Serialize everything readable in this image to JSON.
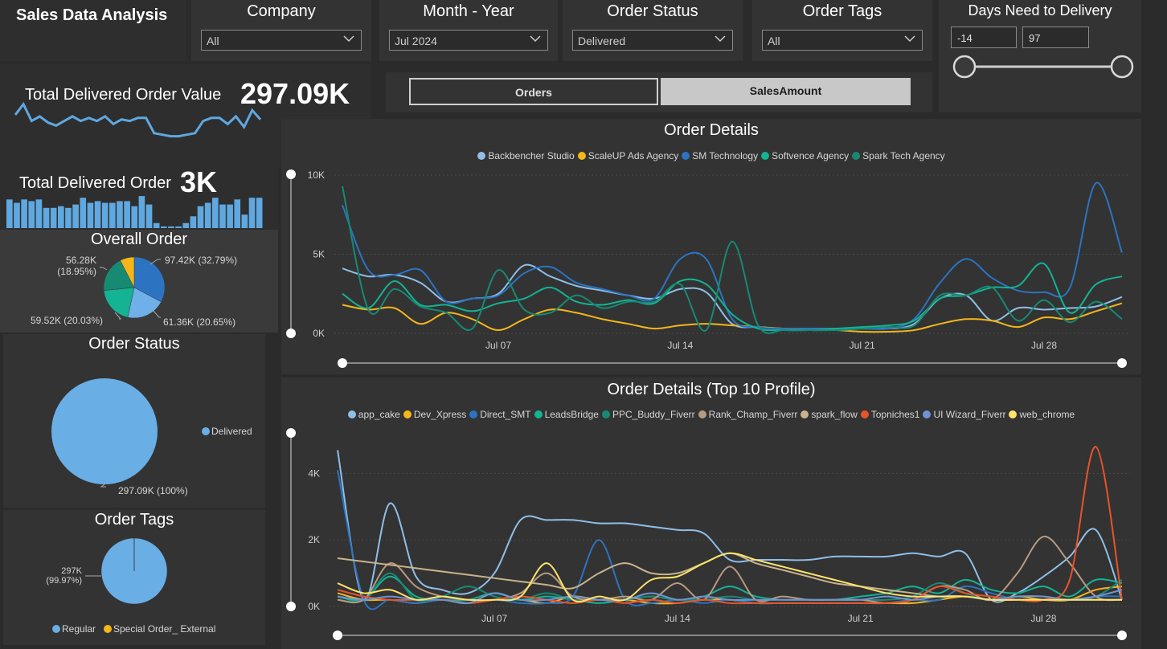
{
  "header": {
    "title": "Sales Data Analysis"
  },
  "slicers": {
    "company": {
      "label": "Company",
      "value": "All"
    },
    "month_year": {
      "label": "Month - Year",
      "value": "Jul 2024"
    },
    "order_status": {
      "label": "Order Status",
      "value": "Delivered"
    },
    "order_tags": {
      "label": "Order Tags",
      "value": "All"
    },
    "days": {
      "label": "Days Need to Delivery",
      "min": "-14",
      "max": "97"
    }
  },
  "kpis": {
    "value_label": "Total Delivered Order Value",
    "value": "297.09K",
    "orders_label": "Total Delivered Order",
    "orders": "3K",
    "value_sparkline": [
      0.5,
      0.85,
      0.3,
      0.45,
      0.25,
      0.15,
      0.3,
      0.45,
      0.3,
      0.4,
      0.3,
      0.45,
      0.2,
      0.35,
      0.3,
      0.4,
      0.4,
      -0.1,
      -0.15,
      -0.2,
      -0.2,
      -0.15,
      -0.1,
      0.3,
      0.4,
      0.4,
      0.2,
      0.45,
      0.1,
      0.65,
      0.35
    ],
    "orders_bars": [
      0.85,
      0.75,
      0.85,
      0.8,
      0.85,
      0.6,
      0.6,
      0.65,
      0.6,
      0.7,
      0.9,
      0.75,
      0.8,
      0.75,
      0.75,
      0.8,
      0.8,
      0.65,
      0.95,
      0.7,
      0.15,
      0.05,
      0.05,
      0.05,
      0.15,
      0.35,
      0.65,
      0.75,
      0.9,
      0.7,
      0.7,
      0.85,
      0.4,
      0.9,
      0.9
    ]
  },
  "toggle": {
    "orders": "Orders",
    "sales": "SalesAmount",
    "active": "SalesAmount"
  },
  "colors": {
    "accent": "#5fa8e0",
    "panel": "#333333",
    "bg": "#2b2b2b"
  },
  "chart_data": [
    {
      "type": "pie",
      "title": "Overall Order",
      "slices": [
        {
          "label": "97.42K (32.79%)",
          "value": 97.42,
          "color": "#2c73c2"
        },
        {
          "label": "61.36K (20.65%)",
          "value": 61.36,
          "color": "#6fb0e8"
        },
        {
          "label": "59.52K (20.03%)",
          "value": 59.52,
          "color": "#13b394"
        },
        {
          "label": "56.28K (18.95%)",
          "value": 56.28,
          "color": "#178a73"
        },
        {
          "label": "",
          "value": 22.5,
          "color": "#f4b61a"
        }
      ]
    },
    {
      "type": "pie",
      "title": "Order Status",
      "slices": [
        {
          "label": "297.09K (100%)",
          "value": 297.09,
          "color": "#6aaee6"
        }
      ],
      "legend": [
        "Delivered"
      ]
    },
    {
      "type": "pie",
      "title": "Order Tags",
      "slices": [
        {
          "label": "297K (99.97%)",
          "value": 99.97,
          "color": "#6aaee6"
        },
        {
          "label": "",
          "value": 0.03,
          "color": "#f4b61a"
        }
      ],
      "legend": [
        "Regular",
        "Special Order_ External"
      ]
    },
    {
      "type": "line",
      "title": "Order Details",
      "x": [
        "Jul 01",
        "Jul 02",
        "Jul 03",
        "Jul 04",
        "Jul 05",
        "Jul 06",
        "Jul 07",
        "Jul 08",
        "Jul 09",
        "Jul 10",
        "Jul 11",
        "Jul 12",
        "Jul 13",
        "Jul 14",
        "Jul 15",
        "Jul 16",
        "Jul 17",
        "Jul 18",
        "Jul 19",
        "Jul 20",
        "Jul 21",
        "Jul 22",
        "Jul 23",
        "Jul 24",
        "Jul 25",
        "Jul 26",
        "Jul 27",
        "Jul 28",
        "Jul 29",
        "Jul 30",
        "Jul 31"
      ],
      "xticks": [
        "Jul 07",
        "Jul 14",
        "Jul 21",
        "Jul 28"
      ],
      "yticks": [
        "0K",
        "5K",
        "10K"
      ],
      "ylim": [
        0,
        10000
      ],
      "series": [
        {
          "name": "Backbencher Studio",
          "color": "#8fbfe8",
          "values": [
            4100,
            3600,
            3700,
            3200,
            2000,
            2200,
            2500,
            4300,
            3600,
            3000,
            2700,
            2400,
            2200,
            2800,
            2600,
            600,
            400,
            300,
            300,
            300,
            300,
            300,
            600,
            2200,
            2400,
            800,
            1600,
            1500,
            1600,
            1700,
            2300
          ]
        },
        {
          "name": "ScaleUP Ads Agency",
          "color": "#f4b61a",
          "values": [
            1800,
            1500,
            1600,
            600,
            1300,
            900,
            200,
            900,
            1500,
            1300,
            900,
            600,
            300,
            500,
            600,
            500,
            400,
            300,
            200,
            200,
            100,
            100,
            200,
            600,
            900,
            800,
            400,
            1000,
            900,
            1400,
            1900
          ]
        },
        {
          "name": "SM Technology",
          "color": "#2c73c2",
          "values": [
            8100,
            4000,
            3700,
            4000,
            2000,
            2200,
            2400,
            3800,
            4200,
            3200,
            2800,
            2400,
            2200,
            4700,
            4700,
            900,
            400,
            300,
            300,
            300,
            300,
            300,
            900,
            3200,
            4700,
            3500,
            2700,
            2600,
            2900,
            9500,
            5100
          ]
        },
        {
          "name": "Softvence Agency",
          "color": "#13b394",
          "values": [
            2500,
            1600,
            3300,
            1800,
            1800,
            1400,
            1900,
            2200,
            2900,
            2000,
            1800,
            2100,
            1900,
            3300,
            3100,
            1200,
            300,
            200,
            200,
            300,
            400,
            500,
            800,
            2200,
            2400,
            2900,
            3000,
            4400,
            1300,
            3100,
            3600
          ]
        },
        {
          "name": "Spark Tech Agency",
          "color": "#178a73",
          "values": [
            9300,
            1500,
            2800,
            1700,
            1300,
            300,
            4000,
            1500,
            1300,
            2400,
            1600,
            2000,
            2000,
            3100,
            200,
            5800,
            500,
            200,
            200,
            200,
            300,
            400,
            500,
            2400,
            2400,
            2900,
            800,
            2100,
            700,
            2000,
            900
          ]
        }
      ]
    },
    {
      "type": "line",
      "title": "Order Details (Top 10 Profile)",
      "x": [
        "Jul 01",
        "Jul 02",
        "Jul 03",
        "Jul 04",
        "Jul 05",
        "Jul 06",
        "Jul 07",
        "Jul 08",
        "Jul 09",
        "Jul 10",
        "Jul 11",
        "Jul 12",
        "Jul 13",
        "Jul 14",
        "Jul 15",
        "Jul 16",
        "Jul 17",
        "Jul 18",
        "Jul 19",
        "Jul 20",
        "Jul 21",
        "Jul 22",
        "Jul 23",
        "Jul 24",
        "Jul 25",
        "Jul 26",
        "Jul 27",
        "Jul 28",
        "Jul 29",
        "Jul 30",
        "Jul 31"
      ],
      "xticks": [
        "Jul 07",
        "Jul 14",
        "Jul 21",
        "Jul 28"
      ],
      "yticks": [
        "0K",
        "2K",
        "4K"
      ],
      "ylim": [
        0,
        5000
      ],
      "series": [
        {
          "name": "app_cake",
          "color": "#8fbfe8",
          "values": [
            4700,
            200,
            3100,
            900,
            500,
            400,
            1000,
            2600,
            2600,
            2600,
            2500,
            2500,
            2400,
            2300,
            2200,
            1400,
            1400,
            1400,
            1400,
            1500,
            1500,
            1500,
            1600,
            1500,
            1600,
            200,
            400,
            900,
            1500,
            2300,
            200
          ]
        },
        {
          "name": "Dev_Xpress",
          "color": "#f4b61a",
          "values": [
            400,
            200,
            200,
            100,
            200,
            100,
            200,
            200,
            100,
            300,
            200,
            200,
            100,
            100,
            200,
            200,
            100,
            100,
            100,
            100,
            100,
            100,
            100,
            200,
            300,
            200,
            300,
            200,
            200,
            500,
            600
          ]
        },
        {
          "name": "Direct_SMT",
          "color": "#2c73c2",
          "values": [
            4100,
            200,
            200,
            100,
            200,
            100,
            200,
            100,
            100,
            300,
            2000,
            200,
            100,
            200,
            100,
            200,
            100,
            100,
            100,
            100,
            100,
            100,
            200,
            200,
            600,
            400,
            200,
            200,
            200,
            300,
            300
          ]
        },
        {
          "name": "LeadsBridge",
          "color": "#13b394",
          "values": [
            300,
            200,
            900,
            300,
            200,
            200,
            400,
            200,
            300,
            200,
            100,
            200,
            300,
            200,
            300,
            600,
            300,
            200,
            200,
            200,
            300,
            400,
            600,
            400,
            800,
            500,
            400,
            600,
            300,
            800,
            700
          ]
        },
        {
          "name": "PPC_Buddy_Fiverr",
          "color": "#178a73",
          "values": [
            200,
            200,
            1000,
            200,
            300,
            600,
            300,
            200,
            400,
            200,
            200,
            200,
            300,
            200,
            200,
            300,
            200,
            200,
            200,
            200,
            200,
            200,
            300,
            700,
            400,
            200,
            300,
            300,
            200,
            300,
            800
          ]
        },
        {
          "name": "Rank_Champ_Fiverr",
          "color": "#b89a80",
          "values": [
            200,
            200,
            1300,
            600,
            300,
            200,
            200,
            400,
            1000,
            300,
            200,
            300,
            200,
            700,
            200,
            1200,
            200,
            300,
            200,
            200,
            200,
            100,
            200,
            600,
            500,
            200,
            1000,
            2100,
            1300,
            300,
            200
          ]
        },
        {
          "name": "spark_flow",
          "color": "#c8b38c",
          "values": [
            1450,
            1350,
            1250,
            1150,
            1050,
            950,
            850,
            750,
            650,
            550,
            1000,
            1300,
            1000,
            1000,
            1300,
            1600,
            1300,
            1100,
            900,
            700,
            600,
            500,
            400,
            300,
            300,
            200,
            200,
            200,
            200,
            200,
            200
          ]
        },
        {
          "name": "Topniches1",
          "color": "#e8542a",
          "values": [
            500,
            300,
            200,
            200,
            200,
            100,
            200,
            300,
            200,
            100,
            200,
            100,
            200,
            100,
            200,
            100,
            100,
            100,
            100,
            100,
            100,
            100,
            200,
            600,
            400,
            300,
            200,
            200,
            800,
            4800,
            200
          ]
        },
        {
          "name": "UI Wizard_Fiverr",
          "color": "#6f93d6",
          "values": [
            300,
            200,
            300,
            200,
            200,
            100,
            400,
            200,
            200,
            300,
            200,
            200,
            400,
            200,
            300,
            200,
            200,
            200,
            200,
            200,
            200,
            300,
            200,
            300,
            300,
            200,
            300,
            300,
            200,
            300,
            500
          ]
        },
        {
          "name": "web_chrome",
          "color": "#ffe36b",
          "values": [
            700,
            400,
            500,
            200,
            300,
            200,
            200,
            300,
            1300,
            200,
            300,
            200,
            800,
            900,
            1300,
            1600,
            1400,
            1200,
            1000,
            800,
            600,
            400,
            300,
            300,
            300,
            200,
            200,
            200,
            200,
            200,
            200
          ]
        }
      ]
    }
  ]
}
